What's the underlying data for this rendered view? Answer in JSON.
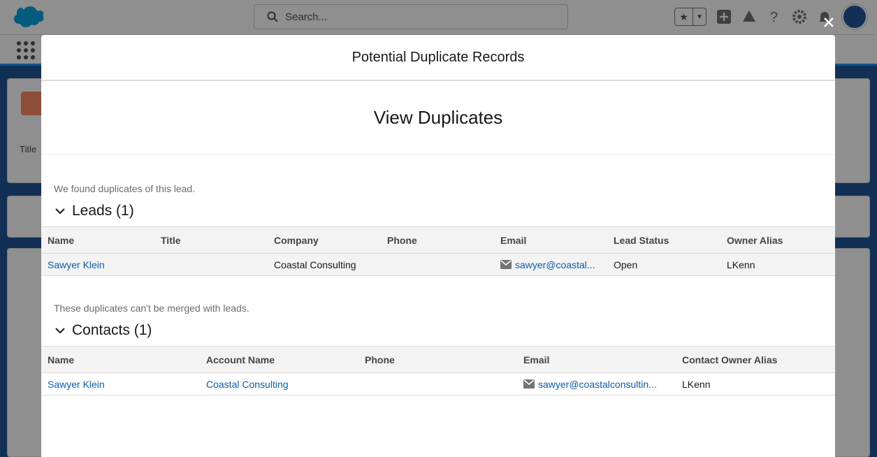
{
  "search": {
    "placeholder": "Search..."
  },
  "background": {
    "title_label": "Title"
  },
  "modal": {
    "title": "Potential Duplicate Records",
    "subtitle": "View Duplicates",
    "close_label": "×"
  },
  "leads": {
    "note": "We found duplicates of this lead.",
    "heading": "Leads (1)",
    "columns": [
      "Name",
      "Title",
      "Company",
      "Phone",
      "Email",
      "Lead Status",
      "Owner Alias"
    ],
    "rows": [
      {
        "name": "Sawyer Klein",
        "title": "",
        "company": "Coastal Consulting",
        "phone": "",
        "email": "sawyer@coastal...",
        "status": "Open",
        "owner": "LKenn"
      }
    ]
  },
  "contacts": {
    "note": "These duplicates can't be merged with leads.",
    "heading": "Contacts (1)",
    "columns": [
      "Name",
      "Account Name",
      "Phone",
      "Email",
      "Contact Owner Alias"
    ],
    "rows": [
      {
        "name": "Sawyer Klein",
        "account": "Coastal Consulting",
        "phone": "",
        "email": "sawyer@coastalconsultin...",
        "owner": "LKenn"
      }
    ]
  },
  "colors": {
    "brand_blue": "#1b96ff",
    "link": "#0b5cab",
    "lead_orange": "#f88962"
  }
}
